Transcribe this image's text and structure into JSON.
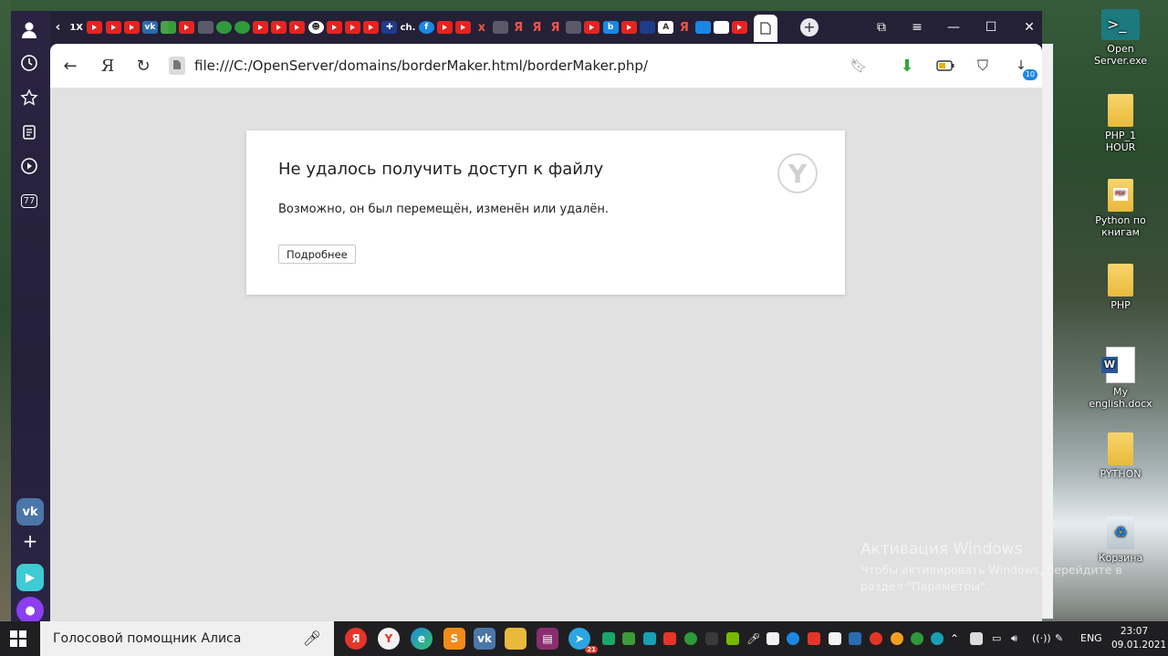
{
  "browser": {
    "url": "file:///C:/OpenServer/domains/borderMaker.html/borderMaker.php/",
    "downloads_badge": "10",
    "sidebar_counter": "77",
    "tab_text_labels": [
      "1X",
      "ch.",
      "Я"
    ]
  },
  "error_page": {
    "title": "Не удалось получить доступ к файлу",
    "message": "Возможно, он был перемещён, изменён или удалён.",
    "details_button": "Подробнее"
  },
  "desktop": {
    "icons": [
      {
        "label": "Open Server.exe",
        "icon": "terminal-icon"
      },
      {
        "label": "PHP_1 HOUR",
        "icon": "folder-icon"
      },
      {
        "label": "Python по книгам",
        "icon": "pdf-folder-icon"
      },
      {
        "label": "PHP",
        "icon": "folder-icon"
      },
      {
        "label": "My english.docx",
        "icon": "word-doc-icon"
      },
      {
        "label": "PYTHON",
        "icon": "folder-icon"
      },
      {
        "label": "Корзина",
        "icon": "recycle-bin-icon"
      }
    ],
    "activation_title": "Активация Windows",
    "activation_text": "Чтобы активировать Windows, перейдите в раздел \"Параметры\"."
  },
  "taskbar": {
    "search_placeholder": "Голосовой помощник Алиса",
    "telegram_badge": "21",
    "language": "ENG",
    "time": "23:07",
    "date": "09.01.2021"
  },
  "colors": {
    "browser_frame": "#242036",
    "page_background": "#e1e1e1",
    "youtube_red": "#e52420",
    "accent_blue": "#1a87e6"
  }
}
